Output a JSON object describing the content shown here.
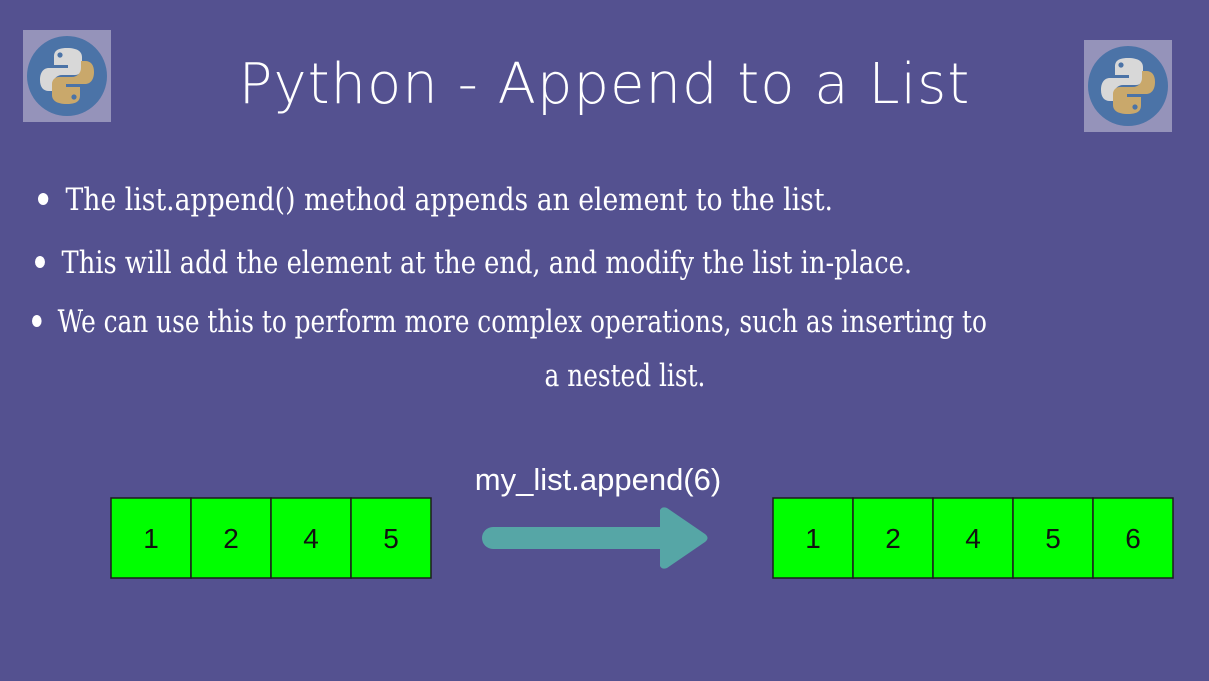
{
  "title": "Python - Append to a List",
  "colors": {
    "background": "#545190",
    "text": "#ffffff",
    "cell_fill": "#00ff00",
    "cell_border": "#1d1d1d",
    "arrow": "#56a6a6",
    "python_blue": "#4b73a7",
    "python_yellow": "#c9a86b"
  },
  "icons": {
    "logo_left": "python-logo-icon",
    "logo_right": "python-logo-icon",
    "arrow": "right-arrow-icon"
  },
  "bullets": [
    "The list.append() method appends an element to the list.",
    "This will add the element at the end, and modify the list in-place.",
    "We can use this to perform more complex operations, such as inserting to"
  ],
  "bullet_continuation": "a nested list.",
  "diagram": {
    "operation": "my_list.append(6)",
    "before": [
      "1",
      "2",
      "4",
      "5"
    ],
    "after": [
      "1",
      "2",
      "4",
      "5",
      "6"
    ]
  }
}
